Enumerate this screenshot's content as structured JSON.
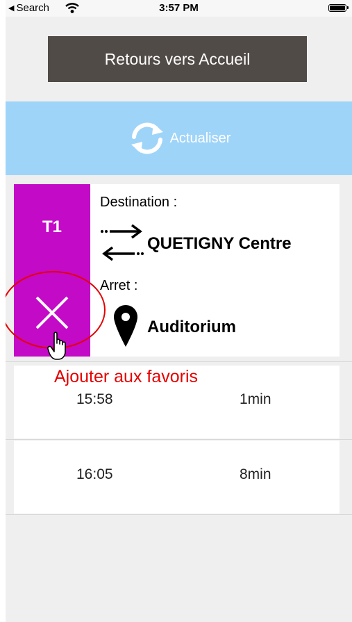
{
  "status_bar": {
    "back_label": "Search",
    "time": "3:57 PM"
  },
  "header": {
    "back_home_label": "Retours vers Accueil",
    "refresh_label": "Actualiser"
  },
  "card": {
    "line_code": "T1",
    "line_color": "#c30ac7",
    "destination_label": "Destination :",
    "destination_value": "QUETIGNY Centre",
    "stop_label": "Arret :",
    "stop_value": "Auditorium"
  },
  "departures": [
    {
      "time": "15:58",
      "delay": "1min"
    },
    {
      "time": "16:05",
      "delay": "8min"
    }
  ],
  "annotation": {
    "text": "Ajouter aux favoris",
    "color": "#e60000"
  },
  "icons": [
    "wifi-icon",
    "battery-icon",
    "refresh-icon",
    "swap-arrows-icon",
    "location-pin-icon",
    "close-icon",
    "pointer-hand-icon"
  ]
}
